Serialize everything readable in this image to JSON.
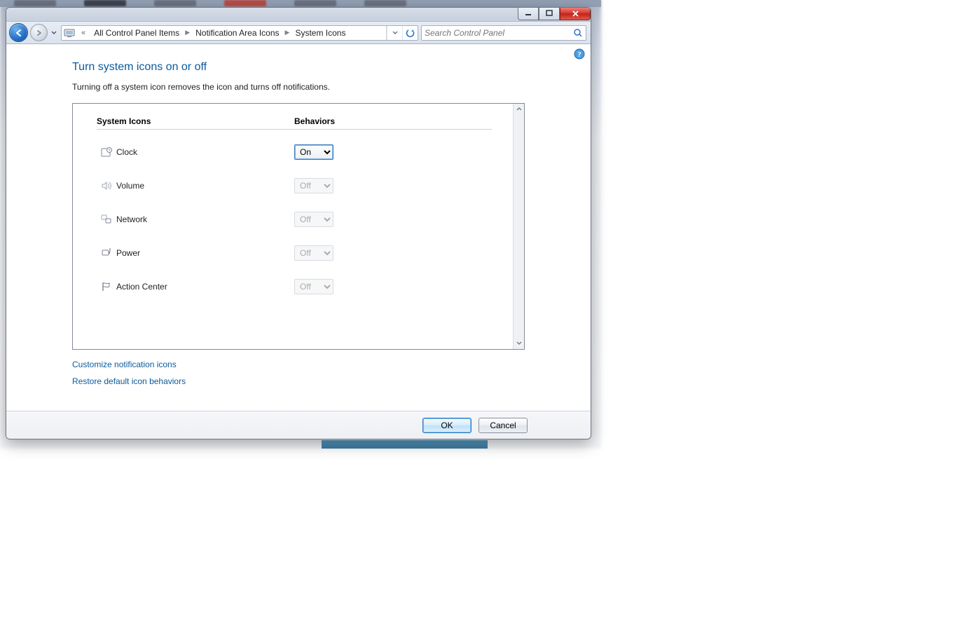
{
  "window": {
    "minimize": "–",
    "maximize": "□",
    "close": "×"
  },
  "breadcrumb": {
    "path0": "All Control Panel Items",
    "path1": "Notification Area Icons",
    "path2": "System Icons"
  },
  "search": {
    "placeholder": "Search Control Panel"
  },
  "page": {
    "title": "Turn system icons on or off",
    "desc": "Turning off a system icon removes the icon and turns off notifications."
  },
  "headers": {
    "icons": "System Icons",
    "behaviors": "Behaviors"
  },
  "rows": [
    {
      "name": "Clock",
      "value": "On",
      "enabled": true
    },
    {
      "name": "Volume",
      "value": "Off",
      "enabled": false
    },
    {
      "name": "Network",
      "value": "Off",
      "enabled": false
    },
    {
      "name": "Power",
      "value": "Off",
      "enabled": false
    },
    {
      "name": "Action Center",
      "value": "Off",
      "enabled": false
    }
  ],
  "options": {
    "on": "On",
    "off": "Off"
  },
  "links": {
    "customize": "Customize notification icons",
    "restore": "Restore default icon behaviors"
  },
  "buttons": {
    "ok": "OK",
    "cancel": "Cancel"
  }
}
